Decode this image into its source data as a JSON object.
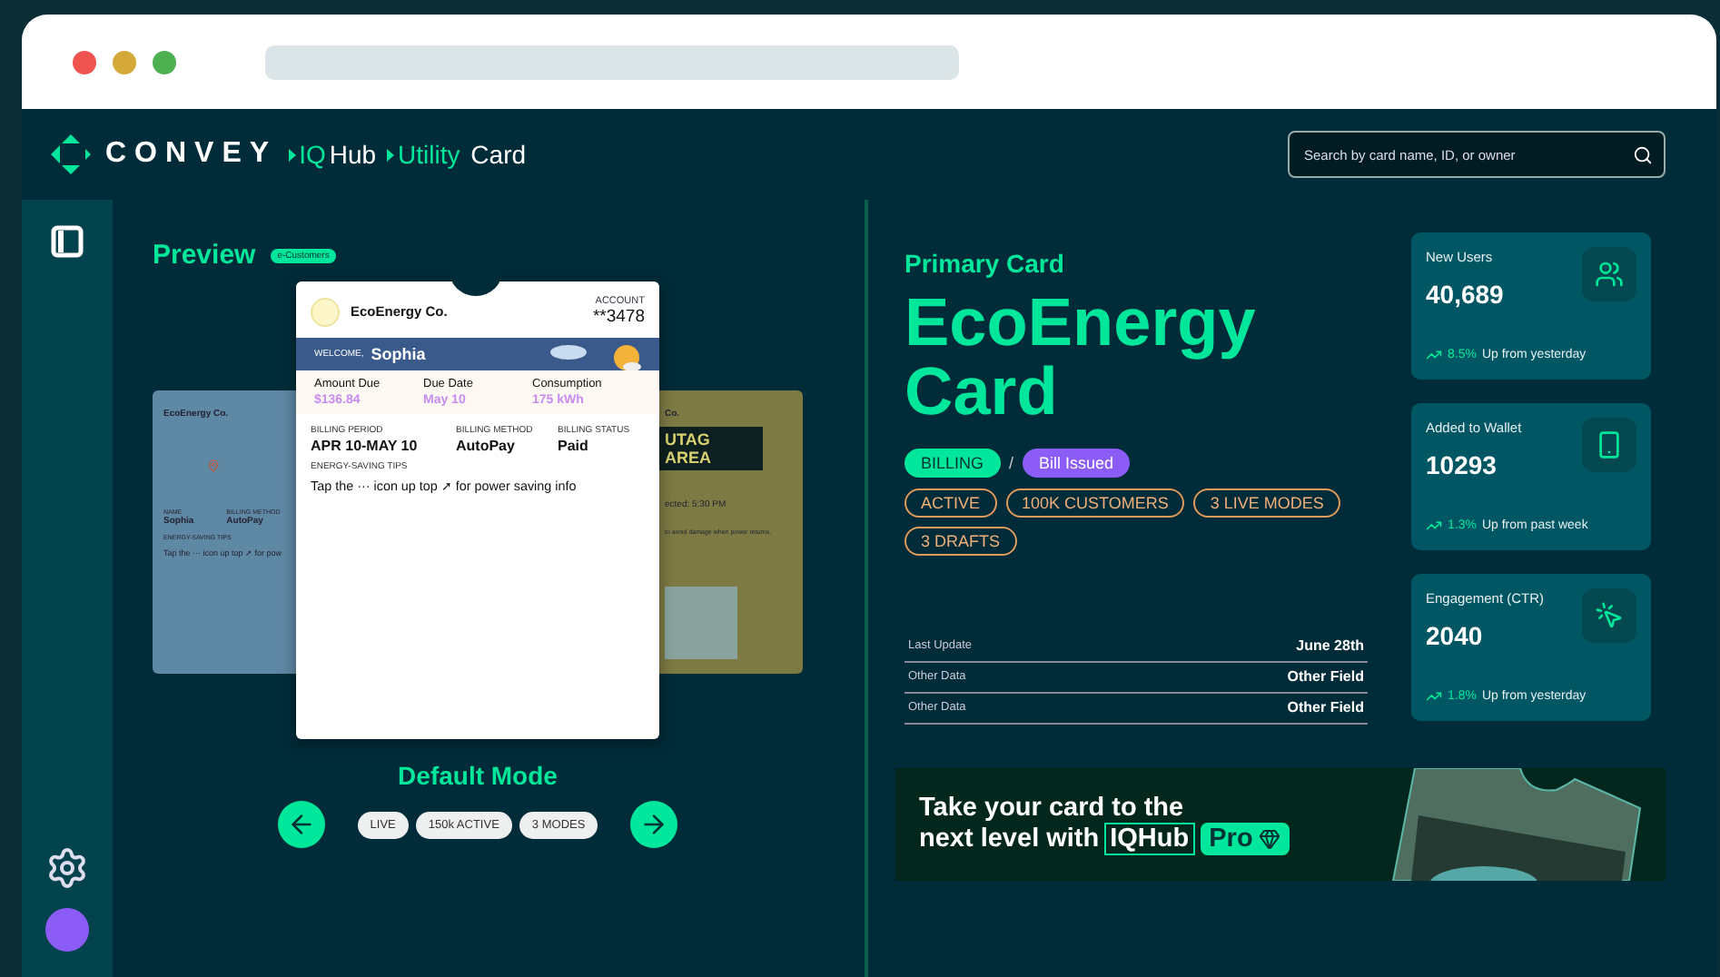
{
  "header": {
    "logo": "CONVEY",
    "breadcrumbs": [
      [
        {
          "text": "IQ",
          "accent": true
        },
        {
          "text": "Hub",
          "accent": false
        }
      ],
      [
        {
          "text": "Utility",
          "accent": true
        },
        {
          "text": " Card",
          "accent": false
        }
      ]
    ],
    "search": {
      "placeholder": "Search by card name, ID, or owner"
    }
  },
  "preview": {
    "title": "Preview",
    "badge": "e-Customers",
    "mode": "Default Mode",
    "chips": [
      "LIVE",
      "150k ACTIVE",
      "3 MODES"
    ],
    "card": {
      "issuer": "EcoEnergy Co.",
      "account_label": "ACCOUNT",
      "account": "**3478",
      "welcome": "WELCOME,",
      "name": "Sophia",
      "summary": [
        {
          "label": "Amount Due",
          "value": "$136.84"
        },
        {
          "label": "Due Date",
          "value": "May 10"
        },
        {
          "label": "Consumption",
          "value": "175 kWh"
        }
      ],
      "billing": [
        {
          "label": "BILLING PERIOD",
          "value": "APR 10-MAY 10"
        },
        {
          "label": "BILLING METHOD",
          "value": "AutoPay"
        },
        {
          "label": "BILLING STATUS",
          "value": "Paid"
        }
      ],
      "tips_label": "ENERGY-SAVING TIPS",
      "tips": "Tap the ··· icon up top ➚ for power saving info"
    },
    "back_left": {
      "issuer": "EcoEnergy Co.",
      "fields": [
        {
          "label": "NAME",
          "value": "Sophia"
        },
        {
          "label": "BILLING METHOD",
          "value": "AutoPay"
        }
      ],
      "tips_label": "ENERGY-SAVING TIPS",
      "tips": "Tap the ··· icon up top ➚ for pow"
    },
    "back_right": {
      "issuer": "Co.",
      "banner": "UTAG\nAREA",
      "line": "ected: 5:30 PM",
      "note": "to avoid damage when power returns."
    }
  },
  "detail": {
    "eyebrow": "Primary Card",
    "title": "EcoEnergy Card",
    "category": "BILLING",
    "separator": "/",
    "status": "Bill Issued",
    "tags": [
      "ACTIVE",
      "100K CUSTOMERS",
      "3 LIVE MODES",
      "3 DRAFTS"
    ],
    "rows": [
      {
        "label": "Last Update",
        "value": "June 28th"
      },
      {
        "label": "Other Data",
        "value": "Other Field"
      },
      {
        "label": "Other Data",
        "value": "Other Field"
      }
    ]
  },
  "stats": [
    {
      "kind": "users",
      "title": "New Users",
      "value": "40,689",
      "change": "8.5%",
      "note": " Up from yesterday"
    },
    {
      "kind": "wallet",
      "title": "Added to Wallet",
      "value": "10293",
      "change": "1.3%",
      "note": " Up from past week"
    },
    {
      "kind": "click",
      "title": "Engagement (CTR)",
      "value": "2040",
      "change": "1.8%",
      "note": " Up from yesterday"
    }
  ],
  "promo": {
    "line1": "Take your card to the",
    "line2": "next level with",
    "brand": "IQHub",
    "tier": "Pro"
  }
}
